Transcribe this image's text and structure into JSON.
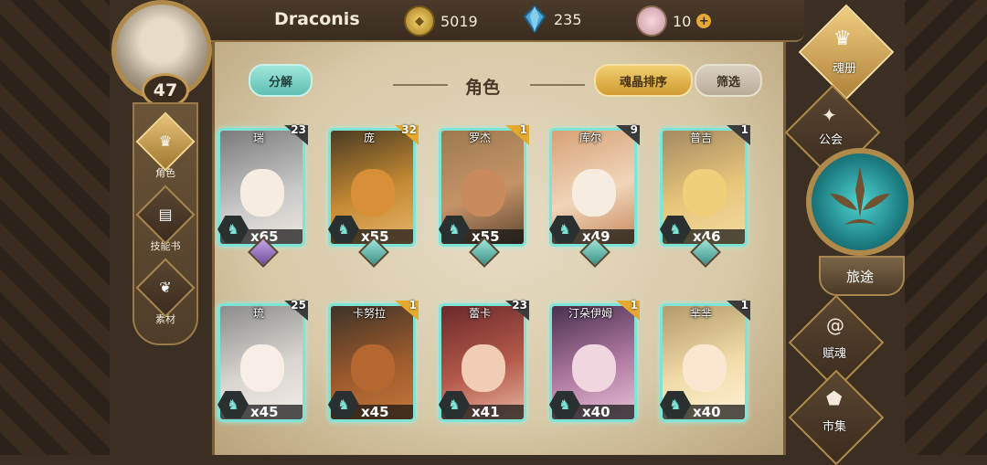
{
  "player": {
    "name": "Draconis",
    "level": "47"
  },
  "resources": {
    "gold": "5019",
    "crystals": "235",
    "gems": "10",
    "add_symbol": "+"
  },
  "page": {
    "title": "角色"
  },
  "buttons": {
    "decompose": "分解",
    "sort": "魂晶排序",
    "filter": "筛选"
  },
  "left_nav": [
    {
      "label": "角色",
      "icon": "helmet-icon",
      "active": true
    },
    {
      "label": "技能书",
      "icon": "book-icon",
      "active": false
    },
    {
      "label": "素材",
      "icon": "material-icon",
      "active": false
    }
  ],
  "right_nav": {
    "soul_book": "魂册",
    "guild": "公会",
    "journey": "旅途",
    "soul_grant": "赋魂",
    "market": "市集"
  },
  "cards": [
    {
      "name": "瑞",
      "level": "23",
      "shards": "x65"
    },
    {
      "name": "庞",
      "level": "32",
      "shards": "x55"
    },
    {
      "name": "罗杰",
      "level": "1",
      "shards": "x55"
    },
    {
      "name": "库尔",
      "level": "9",
      "shards": "x49"
    },
    {
      "name": "普吉",
      "level": "1",
      "shards": "x46"
    },
    {
      "name": "琉",
      "level": "25",
      "shards": "x45"
    },
    {
      "name": "卡努拉",
      "level": "1",
      "shards": "x45"
    },
    {
      "name": "蕾卡",
      "level": "23",
      "shards": "x41"
    },
    {
      "name": "汀朵伊姆",
      "level": "1",
      "shards": "x40"
    },
    {
      "name": "芈芈",
      "level": "1",
      "shards": "x40"
    }
  ]
}
